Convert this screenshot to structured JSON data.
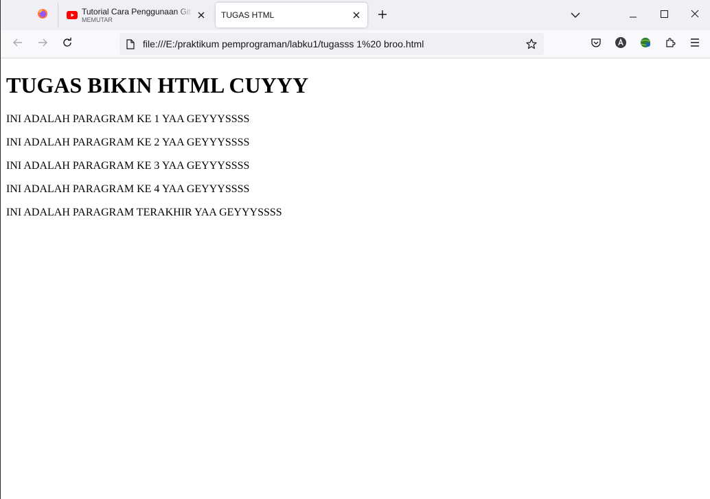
{
  "tabs": [
    {
      "title": "Tutorial Cara Penggunaan Git V",
      "subtitle": "MEMUTAR",
      "icon": "youtube-icon",
      "active": false
    },
    {
      "title": "TUGAS HTML",
      "icon": "",
      "active": true
    }
  ],
  "address_bar": {
    "url": "file:///E:/praktikum pemprograman/labku1/tugasss 1%20 broo.html"
  },
  "page": {
    "heading": "TUGAS BIKIN HTML CUYYY",
    "paragraphs": [
      "INI ADALAH PARAGRAM KE 1 YAA GEYYYSSSS",
      "INI ADALAH PARAGRAM KE 2 YAA GEYYYSSSS",
      "INI ADALAH PARAGRAM KE 3 YAA GEYYYSSSS",
      "INI ADALAH PARAGRAM KE 4 YAA GEYYYSSSS",
      "INI ADALAH PARAGRAM TERAKHIR YAA GEYYYSSSS"
    ]
  },
  "colors": {
    "tabstrip_bg": "#f0f0f4",
    "navbar_bg": "#f9f9fb",
    "youtube_red": "#ff0000"
  }
}
